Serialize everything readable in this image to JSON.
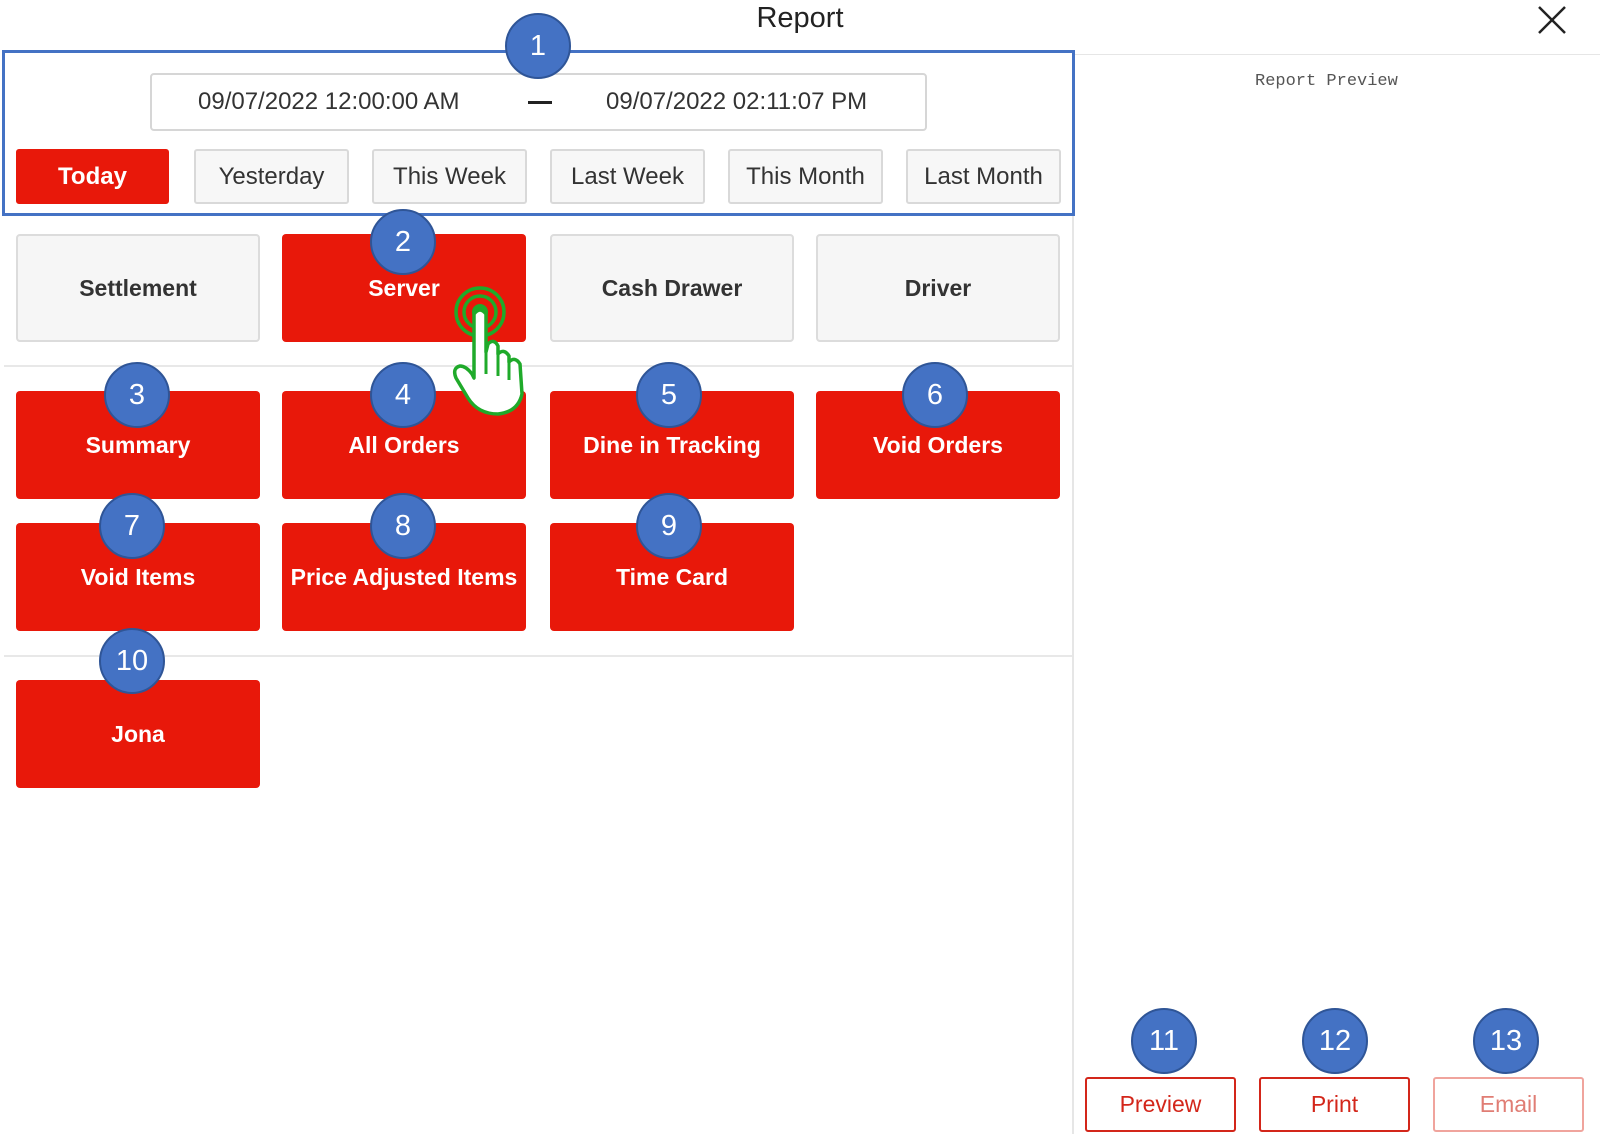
{
  "header": {
    "title": "Report"
  },
  "date_range": {
    "start": "09/07/2022 12:00:00 AM",
    "end": "09/07/2022 02:11:07 PM"
  },
  "quick_ranges": [
    "Today",
    "Yesterday",
    "This Week",
    "Last Week",
    "This Month",
    "Last Month"
  ],
  "selected_quick_range": "Today",
  "categories": [
    "Settlement",
    "Server",
    "Cash Drawer",
    "Driver"
  ],
  "selected_category": "Server",
  "reports": [
    "Summary",
    "All Orders",
    "Dine in Tracking",
    "Void Orders",
    "Void Items",
    "Price Adjusted Items",
    "Time Card"
  ],
  "people": [
    "Jona"
  ],
  "preview": {
    "label": "Report Preview"
  },
  "actions": {
    "preview": "Preview",
    "print": "Print",
    "email": "Email"
  },
  "callouts": [
    "1",
    "2",
    "3",
    "4",
    "5",
    "6",
    "7",
    "8",
    "9",
    "10",
    "11",
    "12",
    "13"
  ],
  "colors": {
    "accent_red": "#e8180a",
    "callout_blue": "#4472c4",
    "cursor_green": "#1faa2a"
  }
}
